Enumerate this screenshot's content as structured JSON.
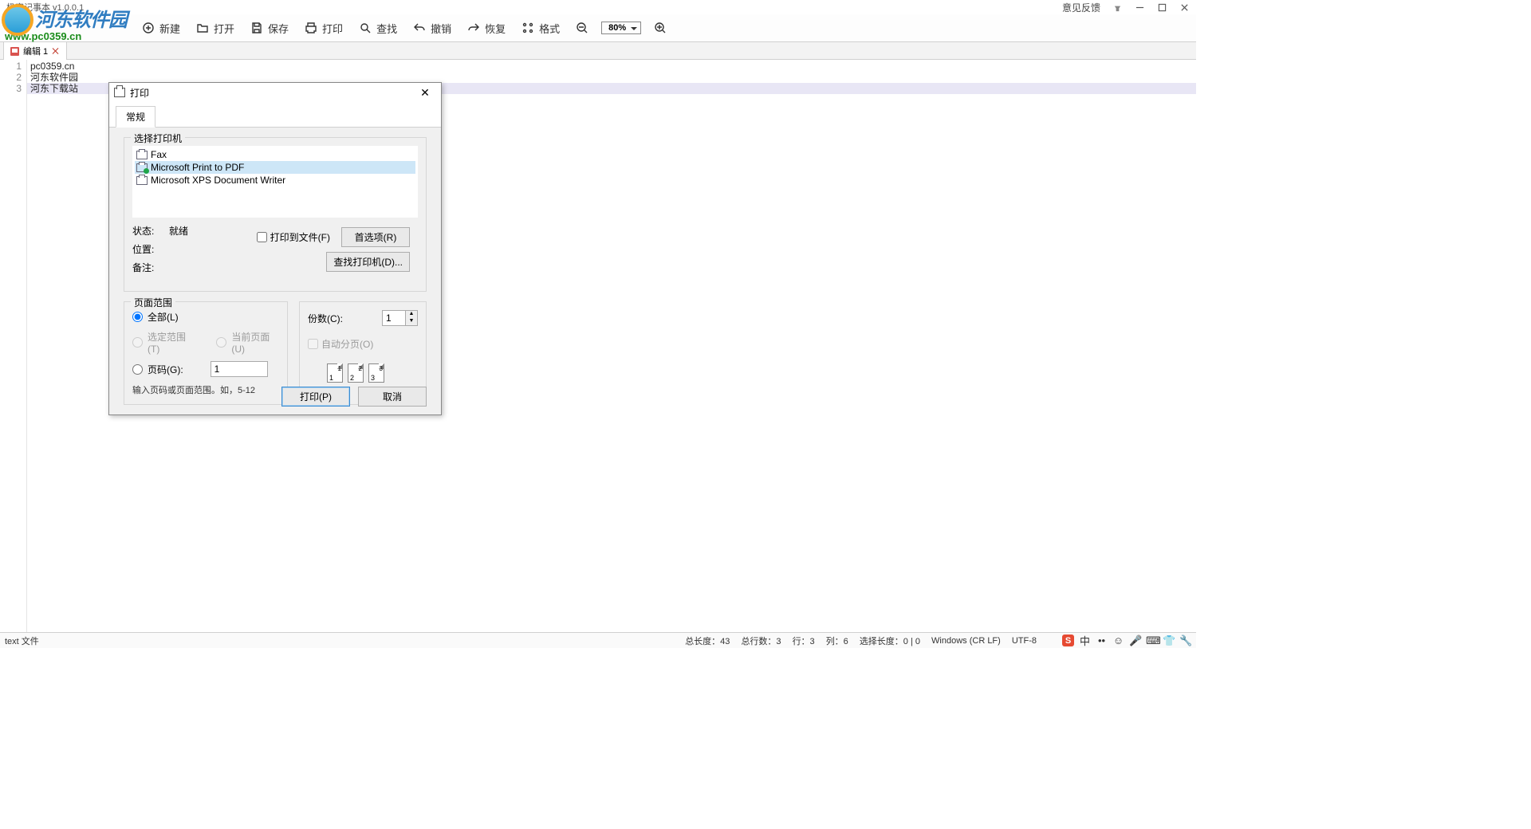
{
  "titlebar": {
    "app_title": "极客记事本 v1.0.0.1",
    "feedback": "意见反馈"
  },
  "watermark": {
    "cn": "河东软件园",
    "url": "www.pc0359.cn"
  },
  "toolbar": {
    "new": "新建",
    "open": "打开",
    "save": "保存",
    "print": "打印",
    "find": "查找",
    "undo": "撤销",
    "redo": "恢复",
    "format": "格式",
    "zoom_value": "80%"
  },
  "tab": {
    "label": "编辑  1"
  },
  "editor": {
    "lines": [
      "pc0359.cn",
      "河东软件园",
      "河东下载站"
    ],
    "selected_index": 2
  },
  "dialog": {
    "title": "打印",
    "tab_general": "常规",
    "select_printer": "选择打印机",
    "printers": [
      "Fax",
      "Microsoft Print to PDF",
      "Microsoft XPS Document Writer"
    ],
    "selected_printer_index": 1,
    "status_label": "状态:",
    "status_value": "就绪",
    "location_label": "位置:",
    "comment_label": "备注:",
    "print_to_file": "打印到文件(F)",
    "preferences": "首选项(R)",
    "find_printer": "查找打印机(D)...",
    "range_legend": "页面范围",
    "range_all": "全部(L)",
    "range_selection": "选定范围(T)",
    "range_current": "当前页面(U)",
    "range_pages": "页码(G):",
    "range_pages_value": "1",
    "range_hint": "输入页码或页面范围。如，5-12",
    "copies_label": "份数(C):",
    "copies_value": "1",
    "collate": "自动分页(O)",
    "collate_pages": [
      [
        "1",
        "1"
      ],
      [
        "2",
        "2"
      ],
      [
        "3",
        "3"
      ]
    ],
    "btn_print": "打印(P)",
    "btn_cancel": "取消"
  },
  "status": {
    "left": "text 文件",
    "total_len": "总长度：43",
    "total_lines": "总行数：3",
    "row": "行：3",
    "col": "列：6",
    "sel": "选择长度：0 | 0",
    "eol": "Windows (CR LF)",
    "enc": "UTF-8",
    "ime_label": "中"
  }
}
